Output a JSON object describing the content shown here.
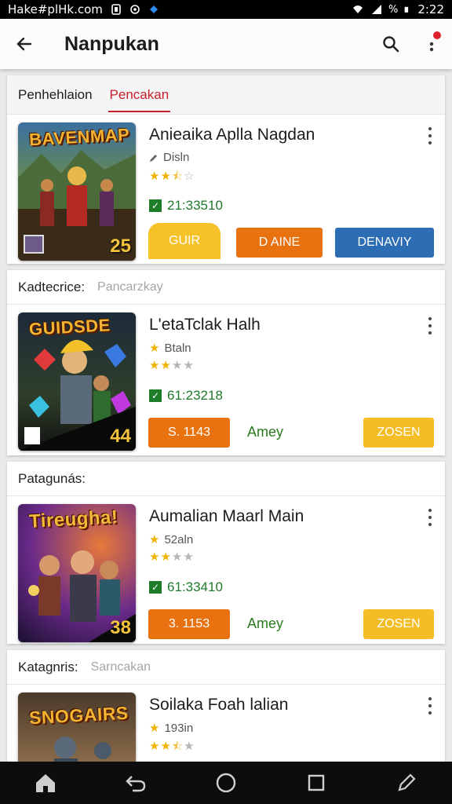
{
  "status": {
    "left_text": "Hake#plHk.com",
    "time": "2:22"
  },
  "header": {
    "title": "Nanpukan"
  },
  "tabs": [
    "Penhehlaion",
    "Pencakan"
  ],
  "sections": [
    {
      "label": "Kadtecrice:",
      "sublabel": "Pancarzkay"
    },
    {
      "label": "Patagunás:",
      "sublabel": ""
    },
    {
      "label": "Katagnris:",
      "sublabel": "Sarncakan"
    }
  ],
  "items": [
    {
      "thumb_title": "BAVENMAP",
      "thumb_number": "25",
      "title": "Anieaika Aplla Nagdan",
      "sub": "Disln",
      "rating": 2.5,
      "check_text": "21:33510",
      "buttons": {
        "gui": "GUIR",
        "mid": "D AINE",
        "right": "DENAVIY"
      }
    },
    {
      "thumb_title": "GUIDSDE",
      "thumb_number": "44",
      "title": "L'etaTclak Halh",
      "sub": "Btaln",
      "rating": 2,
      "check_text": "61:23218",
      "buttons": {
        "left": "S. 1143",
        "mid": "Amey",
        "right": "ZOSEN"
      }
    },
    {
      "thumb_title": "Tireugha!",
      "thumb_number": "38",
      "title": "Aumalian Maarl Main",
      "sub": "52aln",
      "rating": 2,
      "check_text": "61:33410",
      "buttons": {
        "left": "3. 1153",
        "mid": "Amey",
        "right": "ZOSEN"
      }
    },
    {
      "thumb_title": "SNOGAIRS",
      "thumb_number": "",
      "title": "Soilaka Foah lalian",
      "sub": "193in",
      "rating": 2.5,
      "check_text": ""
    }
  ],
  "colors": {
    "accent_red": "#c8202c",
    "orange": "#e8720f",
    "blue": "#2d6db4",
    "yellow": "#f5bd25",
    "green": "#1f7d2a"
  },
  "icons": [
    "back-arrow-icon",
    "search-icon",
    "more-vert-icon",
    "pencil-icon",
    "star-icon",
    "checkbox-icon",
    "home-icon",
    "back-nav-icon",
    "circle-home-icon",
    "recents-icon",
    "edit-icon"
  ]
}
